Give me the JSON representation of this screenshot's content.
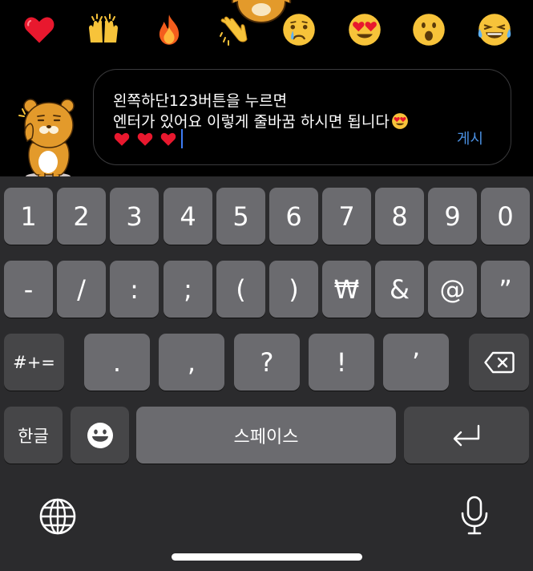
{
  "reactions": [
    {
      "name": "heart-reaction",
      "glyph": "❤️"
    },
    {
      "name": "raising-hands-reaction",
      "glyph": "🙌"
    },
    {
      "name": "fire-reaction",
      "glyph": "🔥"
    },
    {
      "name": "clapping-reaction",
      "glyph": "👏"
    },
    {
      "name": "crying-reaction",
      "glyph": "😢"
    },
    {
      "name": "heart-eyes-reaction",
      "glyph": "😍"
    },
    {
      "name": "surprised-reaction",
      "glyph": "😮"
    },
    {
      "name": "laughing-reaction",
      "glyph": "😂"
    }
  ],
  "composer": {
    "line1": "왼쪽하단123버튼을 누르면",
    "line2": "엔터가 있어요 이렇게 줄바꿈 하시면 됩니다",
    "line3_hearts": "❤️❤️❤️",
    "post_label": "게시"
  },
  "keyboard": {
    "row1": [
      "1",
      "2",
      "3",
      "4",
      "5",
      "6",
      "7",
      "8",
      "9",
      "0"
    ],
    "row2": [
      "-",
      "/",
      ":",
      ";",
      "(",
      ")",
      "₩",
      "&",
      "@",
      "”"
    ],
    "row3_toggle": "#+=",
    "row3": [
      ".",
      ",",
      "?",
      "!",
      "’"
    ],
    "lang_label": "한글",
    "space_label": "스페이스"
  },
  "icons": {
    "emoji_key": "emoji-icon",
    "backspace": "backspace-icon",
    "return": "return-icon",
    "globe": "globe-icon",
    "mic": "microphone-icon"
  }
}
